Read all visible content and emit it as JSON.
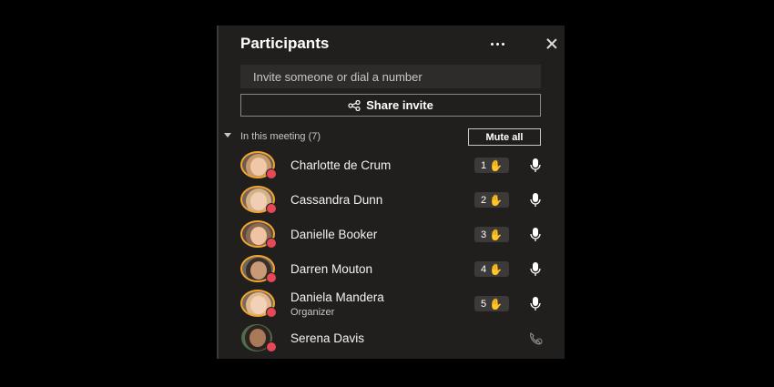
{
  "panel": {
    "title": "Participants",
    "invite_placeholder": "Invite someone or dial a number",
    "share_label": "Share invite",
    "meeting_label": "In this meeting (7)",
    "mute_all_label": "Mute all"
  },
  "participants": [
    {
      "name": "Charlotte de Crum",
      "role": "",
      "hand": "1",
      "mic": "mic-icon"
    },
    {
      "name": "Cassandra Dunn",
      "role": "",
      "hand": "2",
      "mic": "mic-icon"
    },
    {
      "name": "Danielle Booker",
      "role": "",
      "hand": "3",
      "mic": "mic-icon"
    },
    {
      "name": "Darren Mouton",
      "role": "",
      "hand": "4",
      "mic": "mic-icon"
    },
    {
      "name": "Daniela Mandera",
      "role": "Organizer",
      "hand": "5",
      "mic": "mic-icon"
    },
    {
      "name": "Serena Davis",
      "role": "",
      "hand": "",
      "mic": "phone-icon"
    }
  ],
  "colors": {
    "accent_ring": "#f1a72d",
    "status": "#e74856",
    "panel_bg": "#201f1e"
  }
}
